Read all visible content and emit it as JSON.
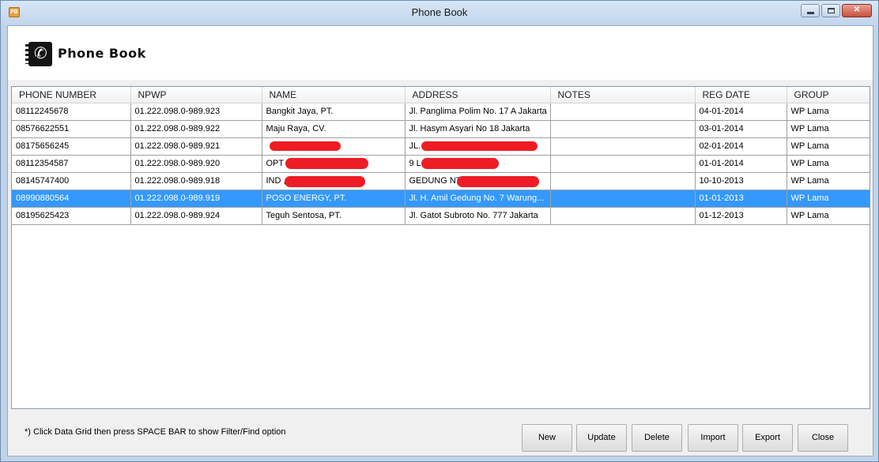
{
  "window": {
    "title": "Phone Book",
    "app_icon": "phonebook-app-icon"
  },
  "header": {
    "logo_text": "Phone Book",
    "logo_icon": "phonebook-logo-icon"
  },
  "grid": {
    "columns": [
      "PHONE NUMBER",
      "NPWP",
      "NAME",
      "ADDRESS",
      "NOTES",
      "REG DATE",
      "GROUP"
    ],
    "rows": [
      {
        "phone": "08112245678",
        "npwp": "01.222.098.0-989.923",
        "name": "Bangkit Jaya, PT.",
        "address": "Jl. Panglima Polim No. 17 A Jakarta",
        "notes": "",
        "reg_date": "04-01-2014",
        "group": "WP Lama",
        "selected": false
      },
      {
        "phone": "08576622551",
        "npwp": "01.222.098.0-989.922",
        "name": "Maju Raya, CV.",
        "address": "Jl. Hasym Asyari No 18 Jakarta",
        "notes": "",
        "reg_date": "03-01-2014",
        "group": "WP Lama",
        "selected": false
      },
      {
        "phone": "08175656245",
        "npwp": "01.222.098.0-989.921",
        "name": "",
        "address": "JL.                    135 ...",
        "notes": "",
        "reg_date": "02-01-2014",
        "group": "WP Lama",
        "selected": false
      },
      {
        "phone": "08112354587",
        "npwp": "01.222.098.0-989.920",
        "name": "OPT                      RES, ...",
        "address": "9 L                   ARAN NO. 9 ...",
        "notes": "",
        "reg_date": "01-01-2014",
        "group": "WP Lama",
        "selected": false
      },
      {
        "phone": "08145747400",
        "npwp": "01.222.098.0-989.918",
        "name": "IND                         , PT.",
        "address": "GEDUNG                    NTE...",
        "notes": "",
        "reg_date": "10-10-2013",
        "group": "WP Lama",
        "selected": false
      },
      {
        "phone": "08990880564",
        "npwp": "01.222.098.0-989.919",
        "name": "POSO ENERGY, PT.",
        "address": "Jl. H. Amil Gedung No. 7 Warung...",
        "notes": "",
        "reg_date": "01-01-2013",
        "group": "WP Lama",
        "selected": true
      },
      {
        "phone": "08195625423",
        "npwp": "01.222.098.0-989.924",
        "name": "Teguh Sentosa, PT.",
        "address": "Jl. Gatot Subroto No. 777 Jakarta",
        "notes": "",
        "reg_date": "01-12-2013",
        "group": "WP Lama",
        "selected": false
      }
    ]
  },
  "footer": {
    "hint": "*) Click Data Grid then  press SPACE BAR to show Filter/Find option",
    "buttons": {
      "new": "New",
      "update": "Update",
      "delete": "Delete",
      "import": "Import",
      "export": "Export",
      "close": "Close"
    }
  },
  "colors": {
    "selection": "#3399ff",
    "redaction": "#ee1c24",
    "titlebar": "#c9dbef"
  }
}
